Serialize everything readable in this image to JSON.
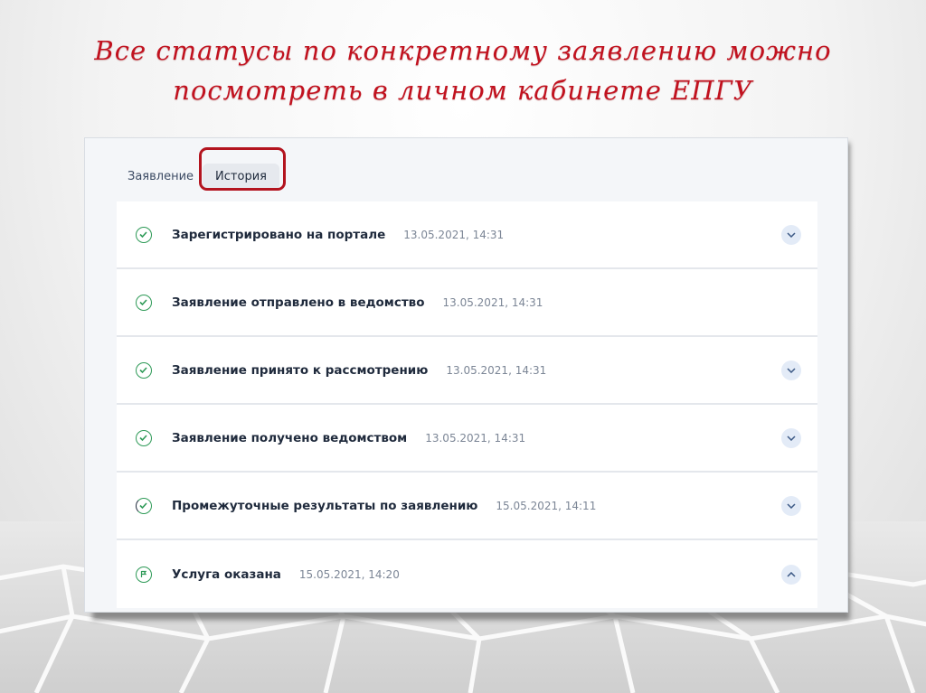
{
  "slide": {
    "title_line1": "Все статусы по конкретному заявлению можно",
    "title_line2": "посмотреть в личном кабинете ЕПГУ"
  },
  "tabs": [
    {
      "label": "Заявление",
      "active": false
    },
    {
      "label": "История",
      "active": true
    }
  ],
  "history": [
    {
      "status": "Зарегистрировано на портале",
      "datetime": "13.05.2021, 14:31",
      "icon": "check-circle-icon",
      "expander": "chevron-down-icon"
    },
    {
      "status": "Заявление отправлено в ведомство",
      "datetime": "13.05.2021, 14:31",
      "icon": "check-circle-icon",
      "expander": null
    },
    {
      "status": "Заявление принято к рассмотрению",
      "datetime": "13.05.2021, 14:31",
      "icon": "check-circle-icon",
      "expander": "chevron-down-icon"
    },
    {
      "status": "Заявление получено ведомством",
      "datetime": "13.05.2021, 14:31",
      "icon": "check-circle-icon",
      "expander": "chevron-down-icon"
    },
    {
      "status": "Промежуточные результаты по заявлению",
      "datetime": "15.05.2021, 14:11",
      "icon": "check-circle-icon",
      "expander": "chevron-down-icon"
    },
    {
      "status": "Услуга оказана",
      "datetime": "15.05.2021, 14:20",
      "icon": "flag-circle-icon",
      "expander": "chevron-up-icon"
    }
  ],
  "colors": {
    "title": "#c1121f",
    "highlight": "#b3141f",
    "check": "#2e9a57",
    "chevron_bg": "#e3ebf7"
  }
}
